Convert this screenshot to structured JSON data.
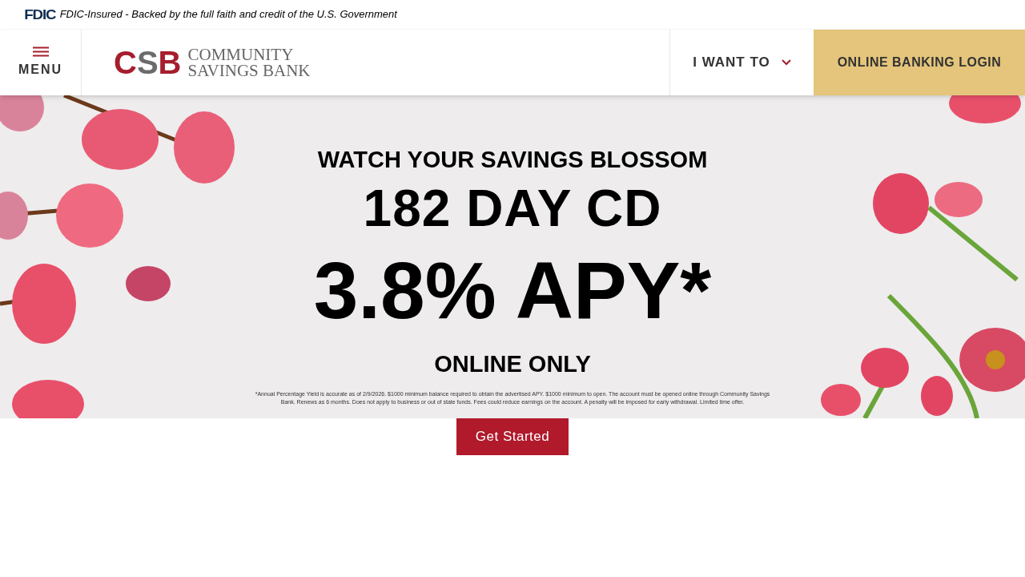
{
  "top_bar": {
    "badge": "FDIC",
    "notice": "FDIC-Insured - Backed by the full faith and credit of the U.S. Government"
  },
  "header": {
    "menu_label": "MENU",
    "logo": {
      "mark": [
        "C",
        "S",
        "B"
      ],
      "line_1": "COMMUNITY",
      "line_2": "SAVINGS BANK"
    },
    "dropdown": {
      "label": "I WANT TO",
      "expanded": false
    },
    "login": "ONLINE BANKING LOGIN"
  },
  "banner": {
    "kicker": "WATCH YOUR SAVINGS BLOSSOM",
    "headline": "182 DAY CD",
    "rate": "3.8% APY*",
    "tag": "ONLINE ONLY",
    "disclaimer": "*Annual Percentage Yield is accurate as of 2/9/2026. $1000 minimum balance required to obtain the advertised APY. $1000 minimum to open. The account must be opened online through Community Savings Bank. Renews as 6 months. Does not apply to business or out of state funds. Fees could reduce earnings on the account. A penalty will be imposed for early withdrawal. Limited time offer."
  },
  "cta": "Get Started"
}
